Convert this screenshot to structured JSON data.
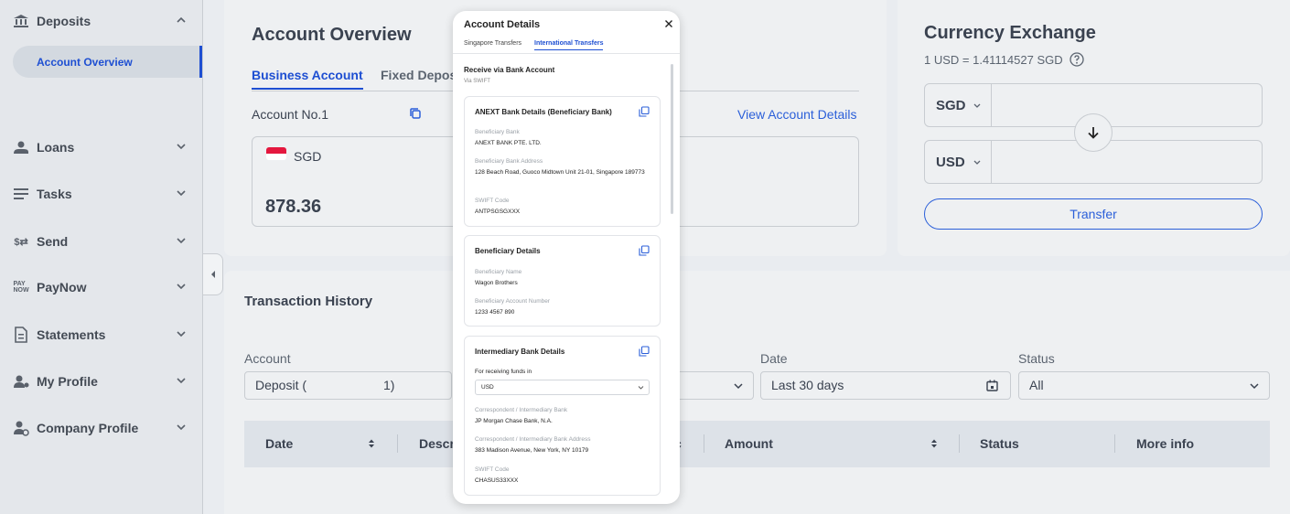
{
  "sidebar": {
    "items": [
      {
        "label": "Deposits",
        "icon": "bank-icon"
      },
      {
        "label": "Loans",
        "icon": "loan-icon"
      },
      {
        "label": "Tasks",
        "icon": "tasks-icon"
      },
      {
        "label": "Send",
        "icon": "send-icon"
      },
      {
        "label": "PayNow",
        "icon": "paynow-icon"
      },
      {
        "label": "Statements",
        "icon": "document-icon"
      },
      {
        "label": "My Profile",
        "icon": "user-icon"
      },
      {
        "label": "Company Profile",
        "icon": "company-user-icon"
      }
    ],
    "sub_active": "Account Overview",
    "accent_color": "#1e4fd2"
  },
  "overview": {
    "title": "Account Overview",
    "tabs": [
      "Business Account",
      "Fixed Deposi"
    ],
    "account_label": "Account No.1",
    "view_details_link": "View Account Details",
    "currency": "SGD",
    "balance": "878.36"
  },
  "exchange": {
    "title": "Currency Exchange",
    "rate": "1 USD = 1.41114527 SGD",
    "from_currency": "SGD",
    "to_currency": "USD",
    "transfer_label": "Transfer"
  },
  "history": {
    "title": "Transaction History",
    "filters": {
      "account_label": "Account",
      "account_value": "Deposit (",
      "account_value_tail": "1)",
      "date_label": "Date",
      "date_value": "Last 30 days",
      "status_label": "Status",
      "status_value": "All"
    },
    "columns": [
      "Date",
      "Descri",
      "Amount",
      "Status",
      "More info"
    ]
  },
  "modal": {
    "title": "Account Details",
    "tabs": [
      "Singapore Transfers",
      "International Transfers"
    ],
    "active_tab": "International Transfers",
    "section_title": "Receive via Bank Account",
    "section_sub": "Via SWIFT",
    "cards": {
      "bank": {
        "title": "ANEXT Bank Details (Beneficiary Bank)",
        "fields": [
          {
            "label": "Beneficiary Bank",
            "value": "ANEXT BANK PTE. LTD."
          },
          {
            "label": "Beneficiary Bank Address",
            "value": "128 Beach Road, Guoco Midtown Unit 21-01, Singapore 189773"
          },
          {
            "label": "SWIFT Code",
            "value": "ANTPSGSGXXX"
          }
        ]
      },
      "beneficiary": {
        "title": "Beneficiary Details",
        "fields": [
          {
            "label": "Beneficiary Name",
            "value": "Wagon Brothers"
          },
          {
            "label": "Beneficiary Account Number",
            "value": "1233 4567 890"
          }
        ]
      },
      "intermediary": {
        "title": "Intermediary Bank Details",
        "select_label": "For receiving funds in",
        "select_value": "USD",
        "fields": [
          {
            "label": "Correspondent / Intermediary Bank",
            "value": "JP Morgan Chase Bank, N.A."
          },
          {
            "label": "Correspondent / Intermediary Bank Address",
            "value": "383 Madison Avenue, New York, NY 10179"
          },
          {
            "label": "SWIFT Code",
            "value": "CHASUS33XXX"
          }
        ]
      }
    }
  }
}
